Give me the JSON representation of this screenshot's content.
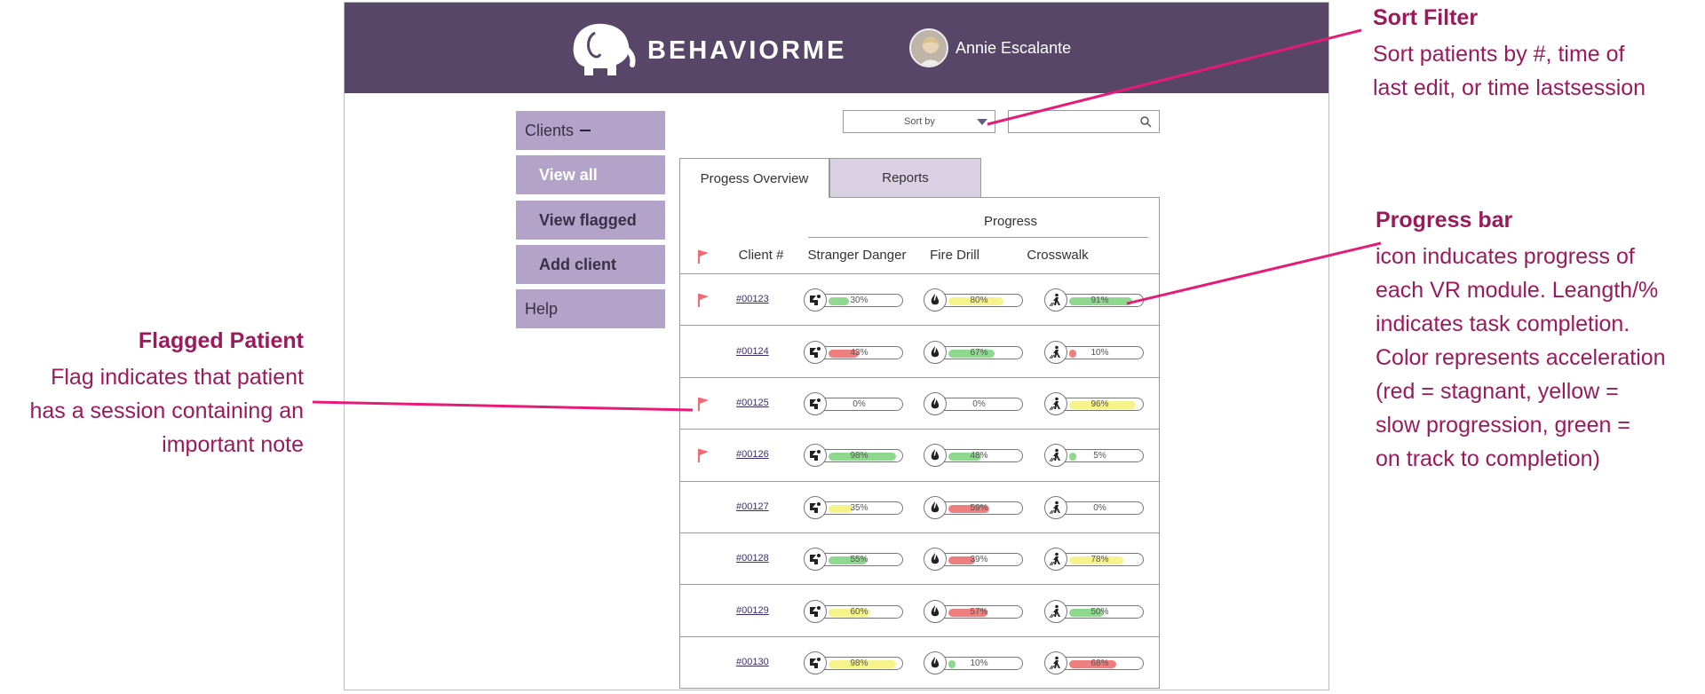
{
  "header": {
    "brand": "BEHAVIORME",
    "user_name": "Annie Escalante"
  },
  "sidebar": {
    "clients_label": "Clients",
    "items": [
      {
        "label": "View all"
      },
      {
        "label": "View flagged"
      },
      {
        "label": "Add client"
      }
    ],
    "help_label": "Help"
  },
  "controls": {
    "sort_label": "Sort by",
    "search_placeholder": ""
  },
  "tabs": {
    "progress_overview": "Progess Overview",
    "reports": "Reports"
  },
  "table": {
    "progress_header": "Progress",
    "col_client": "Client #",
    "col_stranger": "Stranger Danger",
    "col_fire": "Fire Drill",
    "col_crosswalk": "Crosswalk",
    "rows": [
      {
        "client": "#00123",
        "flagged": true,
        "stranger": {
          "pct": 30,
          "text": "30%",
          "color": "green"
        },
        "fire": {
          "pct": 80,
          "text": "80%",
          "color": "yellow"
        },
        "cross": {
          "pct": 91,
          "text": "91%",
          "color": "green"
        }
      },
      {
        "client": "#00124",
        "flagged": false,
        "stranger": {
          "pct": 43,
          "text": "43%",
          "color": "red"
        },
        "fire": {
          "pct": 67,
          "text": "67%",
          "color": "green"
        },
        "cross": {
          "pct": 10,
          "text": "10%",
          "color": "red"
        }
      },
      {
        "client": "#00125",
        "flagged": true,
        "stranger": {
          "pct": 0,
          "text": "0%",
          "color": "none"
        },
        "fire": {
          "pct": 0,
          "text": "0%",
          "color": "none"
        },
        "cross": {
          "pct": 96,
          "text": "96%",
          "color": "yellow"
        }
      },
      {
        "client": "#00126",
        "flagged": true,
        "stranger": {
          "pct": 98,
          "text": "98%",
          "color": "green"
        },
        "fire": {
          "pct": 48,
          "text": "48%",
          "color": "green"
        },
        "cross": {
          "pct": 5,
          "text": "5%",
          "color": "green"
        }
      },
      {
        "client": "#00127",
        "flagged": false,
        "stranger": {
          "pct": 35,
          "text": "35%",
          "color": "yellow"
        },
        "fire": {
          "pct": 59,
          "text": "59%",
          "color": "red"
        },
        "cross": {
          "pct": 0,
          "text": "0%",
          "color": "none"
        }
      },
      {
        "client": "#00128",
        "flagged": false,
        "stranger": {
          "pct": 55,
          "text": "55%",
          "color": "green"
        },
        "fire": {
          "pct": 39,
          "text": "39%",
          "color": "red"
        },
        "cross": {
          "pct": 78,
          "text": "78%",
          "color": "yellow"
        }
      },
      {
        "client": "#00129",
        "flagged": false,
        "stranger": {
          "pct": 60,
          "text": "60%",
          "color": "yellow"
        },
        "fire": {
          "pct": 57,
          "text": "57%",
          "color": "red"
        },
        "cross": {
          "pct": 50,
          "text": "50%",
          "color": "green"
        }
      },
      {
        "client": "#00130",
        "flagged": false,
        "stranger": {
          "pct": 98,
          "text": "98%",
          "color": "yellow"
        },
        "fire": {
          "pct": 10,
          "text": "10%",
          "color": "green"
        },
        "cross": {
          "pct": 68,
          "text": "68%",
          "color": "red"
        }
      }
    ]
  },
  "annotations": {
    "sort_title": "Sort Filter",
    "sort_lines": [
      "Sort patients by #, time of",
      "last edit, or time lastsession"
    ],
    "progress_title": "Progress bar",
    "progress_lines": [
      "icon inducates progress of",
      "each VR module.  Leangth/%",
      "indicates task completion.",
      "Color represents acceleration",
      "(red = stagnant, yellow =",
      "slow progression, green =",
      "on track to completion)"
    ],
    "flag_title": "Flagged Patient",
    "flag_lines": [
      "Flag indicates that patient",
      "has a session containing an",
      "important note"
    ]
  },
  "colors": {
    "header_bg": "#574668",
    "sidebar_bg": "#b3a3c8",
    "tab_inactive_bg": "#d9d1e3",
    "annotation_text": "#9c1a5c",
    "annotation_line": "#e81a78",
    "flag": "#f06b78",
    "bar_green": "#8fd88f",
    "bar_yellow": "#f6f38a",
    "bar_red": "#ee7f7f"
  }
}
